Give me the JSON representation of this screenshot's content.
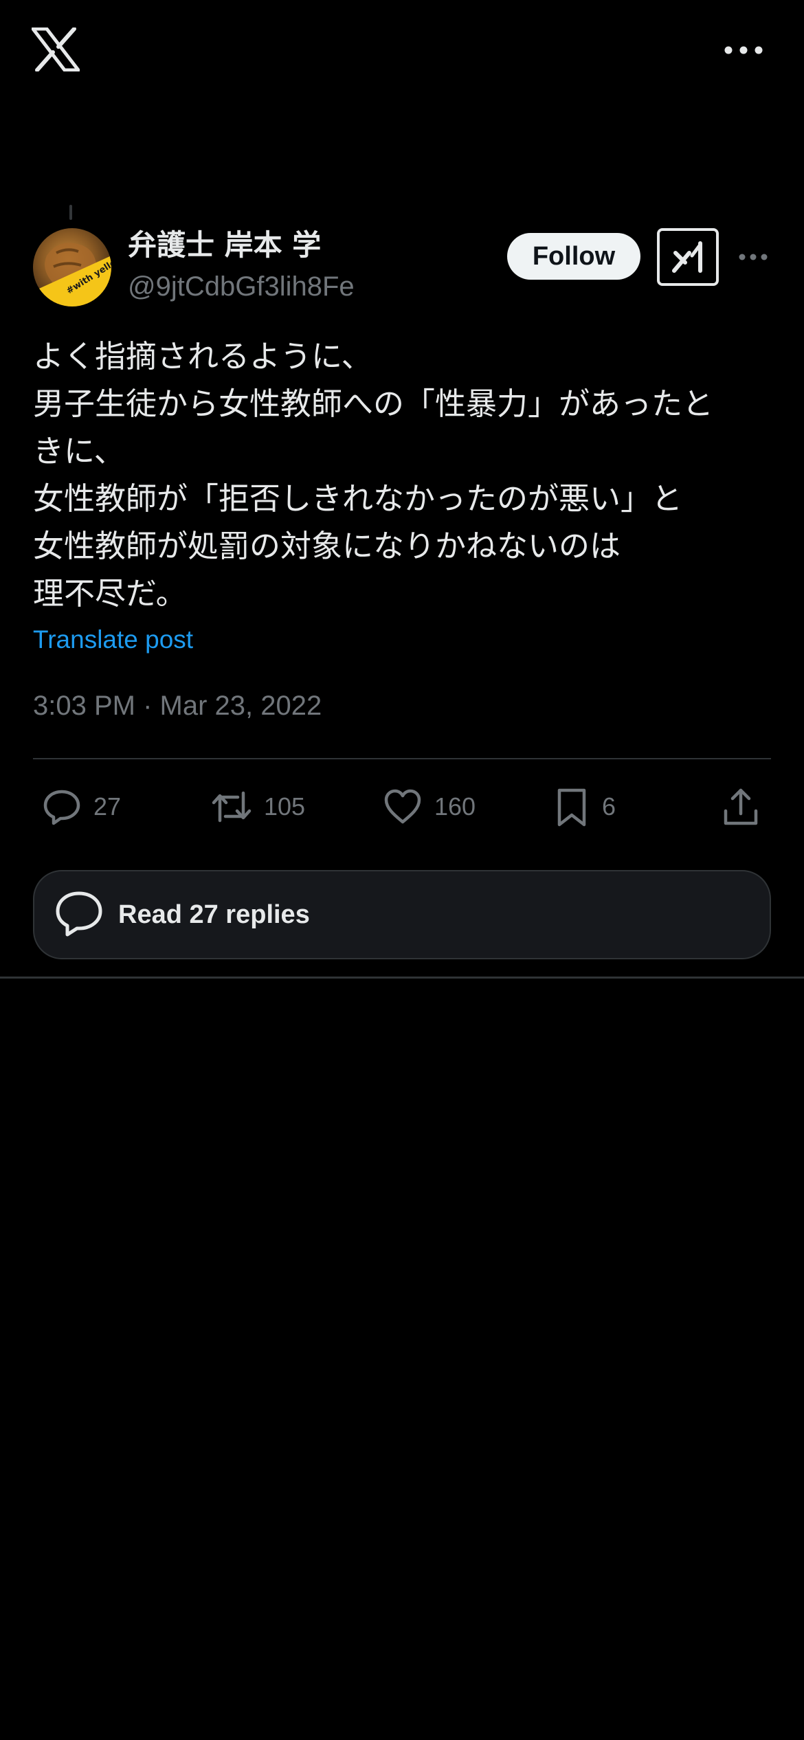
{
  "colors": {
    "background": "#000000",
    "text_primary": "#e7e9ea",
    "text_secondary": "#71767b",
    "link": "#1d9bf0",
    "divider": "#2f3336",
    "follow_bg": "#eff3f4",
    "avatar_badge": "#f5c518"
  },
  "topbar": {
    "logo_icon": "x-logo-icon",
    "more_icon": "more-horizontal-icon"
  },
  "author": {
    "name": "弁護士 岸本 学",
    "handle": "@9jtCdbGf3lih8Fe",
    "avatar_badge_text": "#with yellow",
    "follow_label": "Follow",
    "grok_icon": "grok-icon",
    "more_icon": "more-horizontal-icon"
  },
  "tweet": {
    "lines": [
      "よく指摘されるように、",
      "男子生徒から女性教師への「性暴力」があったと",
      "きに、",
      "女性教師が「拒否しきれなかったのが悪い」と",
      "女性教師が処罰の対象になりかねないのは",
      "理不尽だ。"
    ],
    "translate_label": "Translate post",
    "timestamp": "3:03 PM · Mar 23, 2022"
  },
  "actions": {
    "replies": "27",
    "reposts": "105",
    "likes": "160",
    "bookmarks": "6"
  },
  "read_replies": {
    "label": "Read 27 replies"
  }
}
